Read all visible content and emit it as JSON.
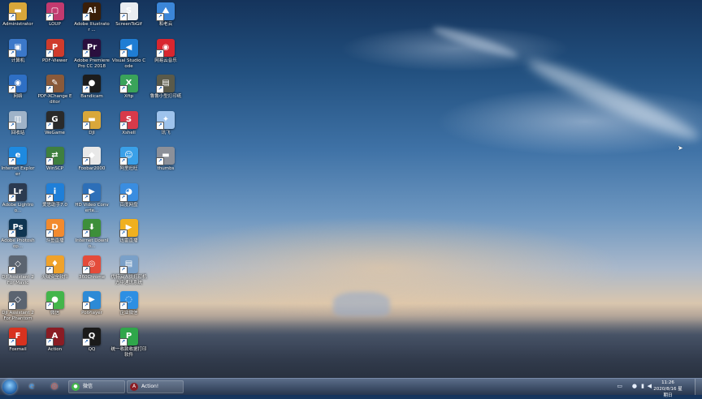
{
  "desktop_icons": [
    {
      "label": "Administrator",
      "icon": "folder-icon",
      "color": "#d9a73a",
      "glyph": "▬"
    },
    {
      "label": "计算机",
      "icon": "computer-icon",
      "color": "#3b78c9",
      "glyph": "▣"
    },
    {
      "label": "网络",
      "icon": "network-icon",
      "color": "#2e6fc4",
      "glyph": "◉"
    },
    {
      "label": "回收站",
      "icon": "recycle-bin-icon",
      "color": "#9fb3c8",
      "glyph": "▥"
    },
    {
      "label": "Internet Explorer",
      "icon": "internet-explorer-icon",
      "color": "#1e8ae0",
      "glyph": "e"
    },
    {
      "label": "Adobe Lightroo...",
      "icon": "lightroom-icon",
      "color": "#2b3a50",
      "glyph": "Lr"
    },
    {
      "label": "Adobe Photoshop...",
      "icon": "photoshop-icon",
      "color": "#0f3552",
      "glyph": "Ps"
    },
    {
      "label": "DJI Assistant 2 For Mavic",
      "icon": "dji-assistant-icon",
      "color": "#5b6470",
      "glyph": "◇"
    },
    {
      "label": "DJI Assistant 2 For Phantom",
      "icon": "dji-assistant-icon",
      "color": "#5b6470",
      "glyph": "◇"
    },
    {
      "label": "Foxmail",
      "icon": "foxmail-icon",
      "color": "#d8321f",
      "glyph": "F"
    },
    {
      "label": "LOUP",
      "icon": "loup-icon",
      "color": "#c23a6f",
      "glyph": "▢"
    },
    {
      "label": "PDF-Viewer",
      "icon": "pdf-viewer-icon",
      "color": "#cf3b2c",
      "glyph": "P"
    },
    {
      "label": "PDF-XChange Editor",
      "icon": "pdf-xchange-icon",
      "color": "#8a5a3a",
      "glyph": "✎"
    },
    {
      "label": "WeGame",
      "icon": "wegame-icon",
      "color": "#2a2a2a",
      "glyph": "G"
    },
    {
      "label": "WinSCP",
      "icon": "winscp-icon",
      "color": "#3f7f3f",
      "glyph": "⇄"
    },
    {
      "label": "爱思助手7.0",
      "icon": "i4-assistant-icon",
      "color": "#1f7fd8",
      "glyph": "i"
    },
    {
      "label": "斗鱼直播",
      "icon": "douyu-icon",
      "color": "#f28a2e",
      "glyph": "D"
    },
    {
      "label": "火绒安全软件",
      "icon": "huorong-icon",
      "color": "#f0a22a",
      "glyph": "♦"
    },
    {
      "label": "微信",
      "icon": "wechat-icon",
      "color": "#43b54a",
      "glyph": "●"
    },
    {
      "label": "Action",
      "icon": "action-icon",
      "color": "#8a1c24",
      "glyph": "A"
    },
    {
      "label": "Adobe Illustrator ...",
      "icon": "illustrator-icon",
      "color": "#3a1e08",
      "glyph": "Ai"
    },
    {
      "label": "Adobe Premiere Pro CC 2018",
      "icon": "premiere-icon",
      "color": "#2a0f3e",
      "glyph": "Pr"
    },
    {
      "label": "Bandicam",
      "icon": "bandicam-icon",
      "color": "#1c1c1c",
      "glyph": "●"
    },
    {
      "label": "DJI",
      "icon": "folder-icon",
      "color": "#d9a73a",
      "glyph": "▬"
    },
    {
      "label": "Foobar2000",
      "icon": "foobar2000-icon",
      "color": "#e8e8e8",
      "glyph": "◆"
    },
    {
      "label": "HD Video Converte...",
      "icon": "video-converter-icon",
      "color": "#2d6fb8",
      "glyph": "▶"
    },
    {
      "label": "Internet Downlo...",
      "icon": "idm-icon",
      "color": "#3d8f3a",
      "glyph": "⬇"
    },
    {
      "label": "360Chrome",
      "icon": "chrome-icon",
      "color": "#e44b3a",
      "glyph": "◎"
    },
    {
      "label": "PotPlayer",
      "icon": "potplayer-icon",
      "color": "#2c8ad6",
      "glyph": "▶"
    },
    {
      "label": "QQ",
      "icon": "qq-icon",
      "color": "#1a1a1a",
      "glyph": "Q"
    },
    {
      "label": "ScreenToGif",
      "icon": "screentogif-icon",
      "color": "#e9edf2",
      "glyph": "S"
    },
    {
      "label": "Visual Studio Code",
      "icon": "vscode-icon",
      "color": "#1f7dd4",
      "glyph": "◀"
    },
    {
      "label": "Xftp",
      "icon": "xftp-icon",
      "color": "#3aa35a",
      "glyph": "X"
    },
    {
      "label": "Xshell",
      "icon": "xshell-icon",
      "color": "#d83a4a",
      "glyph": "S"
    },
    {
      "label": "阿里旺旺",
      "icon": "aliwangwang-icon",
      "color": "#3aa0e8",
      "glyph": "☺"
    },
    {
      "label": "百度网盘",
      "icon": "baidu-netdisk-icon",
      "color": "#3a8de0",
      "glyph": "◕"
    },
    {
      "label": "迅雷直播",
      "icon": "xunlei-live-icon",
      "color": "#f0b01f",
      "glyph": "▶"
    },
    {
      "label": "优特云人员打印机 方中通讯系统",
      "icon": "printer-software-icon",
      "color": "#7aa0c8",
      "glyph": "▤"
    },
    {
      "label": "企业微信",
      "icon": "wework-icon",
      "color": "#2d8fe3",
      "glyph": "◌"
    },
    {
      "label": "统一收款收据打印 软件",
      "icon": "receipt-printer-icon",
      "color": "#2fa64a",
      "glyph": "P"
    },
    {
      "label": "和老云",
      "icon": "cloud-app-icon",
      "color": "#3b86d8",
      "glyph": "⛰"
    },
    {
      "label": "网易云音乐",
      "icon": "netease-music-icon",
      "color": "#d8262f",
      "glyph": "◉"
    },
    {
      "label": "鲁鲁小型打印纸",
      "icon": "printer-app-icon",
      "color": "#5a5a4a",
      "glyph": "▤"
    },
    {
      "label": "讯飞",
      "icon": "xunfei-icon",
      "color": "#9ec3ec",
      "glyph": "✦"
    },
    {
      "label": "thumbs",
      "icon": "folder-icon",
      "color": "#8c9099",
      "glyph": "▬"
    }
  ],
  "taskbar": {
    "pinned": [
      {
        "icon": "ie-taskbar-icon",
        "glyph": "e",
        "color": "#2a8ae0"
      },
      {
        "icon": "chrome-taskbar-icon",
        "glyph": "◎",
        "color": "#e44b3a"
      }
    ],
    "tasks": [
      {
        "label": "微信",
        "icon": "wechat-icon",
        "glyph": "●",
        "color": "#43b54a"
      },
      {
        "label": "Action!",
        "icon": "action-icon",
        "glyph": "A",
        "color": "#8a1c24"
      }
    ],
    "tray": {
      "time": "11:26",
      "date": "2020/8/16 星期日"
    }
  }
}
